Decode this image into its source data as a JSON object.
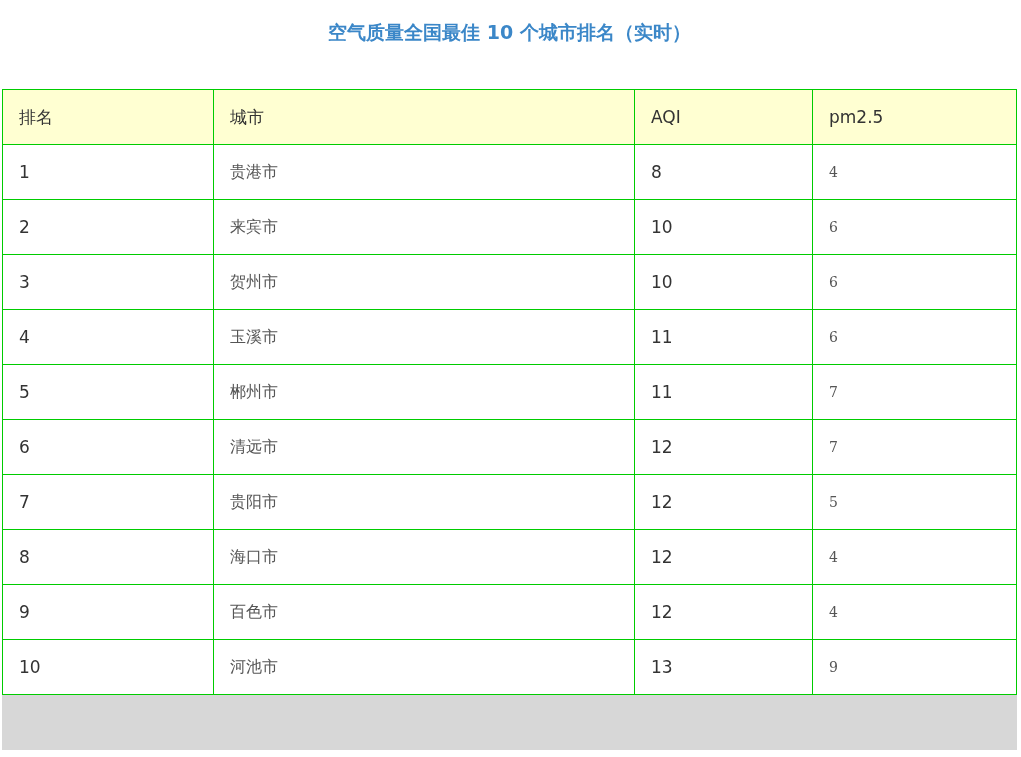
{
  "title": "空气质量全国最佳 10 个城市排名（实时）",
  "table": {
    "columns": [
      "排名",
      "城市",
      "AQI",
      "pm2.5"
    ],
    "rows": [
      [
        "1",
        "贵港市",
        "8",
        "4"
      ],
      [
        "2",
        "来宾市",
        "10",
        "6"
      ],
      [
        "3",
        "贺州市",
        "10",
        "6"
      ],
      [
        "4",
        "玉溪市",
        "11",
        "6"
      ],
      [
        "5",
        "郴州市",
        "11",
        "7"
      ],
      [
        "6",
        "清远市",
        "12",
        "7"
      ],
      [
        "7",
        "贵阳市",
        "12",
        "5"
      ],
      [
        "8",
        "海口市",
        "12",
        "4"
      ],
      [
        "9",
        "百色市",
        "12",
        "4"
      ],
      [
        "10",
        "河池市",
        "13",
        "9"
      ]
    ]
  }
}
